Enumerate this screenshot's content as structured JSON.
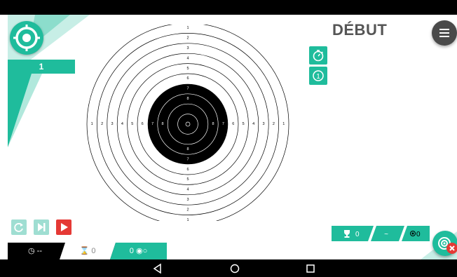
{
  "colors": {
    "accent": "#1fbc9c",
    "danger": "#e53935",
    "disabled": "#9fded2",
    "dark": "#000000"
  },
  "header": {
    "title": "DÉBUT",
    "score_value": "1"
  },
  "target": {
    "ring_labels_top": [
      "1",
      "2",
      "3",
      "4",
      "5",
      "6",
      "7",
      "8"
    ],
    "ring_labels_bottom": [
      "8",
      "7",
      "6",
      "5",
      "4",
      "3",
      "2",
      "1"
    ],
    "ring_labels_left": [
      "1",
      "2",
      "3",
      "4",
      "5",
      "6",
      "7",
      "8"
    ],
    "ring_labels_right": [
      "8",
      "7",
      "6",
      "5",
      "4",
      "3",
      "2",
      "1"
    ]
  },
  "tabs": {
    "timer": "--",
    "series": "0",
    "shots": "0"
  },
  "stats": {
    "trophy_value": "0",
    "average": "~",
    "impacts": "0"
  },
  "icons": {
    "logo": "target-icon",
    "menu": "hamburger-icon",
    "timer": "stopwatch-icon",
    "one": "circled-one-icon",
    "restart": "restart-icon",
    "skip": "skip-next-icon",
    "play": "play-icon",
    "fab": "target-icon",
    "fab_badge": "close-icon"
  }
}
